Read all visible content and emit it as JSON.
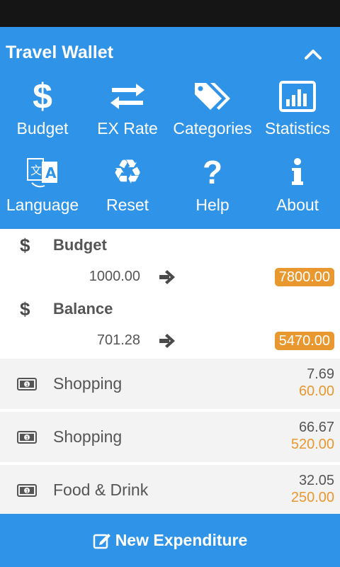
{
  "app": {
    "title": "Travel Wallet",
    "collapse_icon": "chevron-up-icon"
  },
  "menu": [
    {
      "label": "Budget",
      "icon": "dollar-icon"
    },
    {
      "label": "EX Rate",
      "icon": "exchange-arrows-icon"
    },
    {
      "label": "Categories",
      "icon": "tags-icon"
    },
    {
      "label": "Statistics",
      "icon": "bar-chart-icon"
    },
    {
      "label": "Language",
      "icon": "translate-icon"
    },
    {
      "label": "Reset",
      "icon": "recycle-icon"
    },
    {
      "label": "Help",
      "icon": "question-icon"
    },
    {
      "label": "About",
      "icon": "info-icon"
    }
  ],
  "summary": {
    "budget": {
      "title": "Budget",
      "icon": "dollar-icon",
      "local_value": "1000.00",
      "home_value": "7800.00"
    },
    "balance": {
      "title": "Balance",
      "icon": "dollar-icon",
      "local_value": "701.28",
      "home_value": "5470.00"
    }
  },
  "expenditures": [
    {
      "category": "Shopping",
      "local_amount": "7.69",
      "home_amount": "60.00",
      "icon": "money-icon"
    },
    {
      "category": "Shopping",
      "local_amount": "66.67",
      "home_amount": "520.00",
      "icon": "money-icon"
    },
    {
      "category": "Food & Drink",
      "local_amount": "32.05",
      "home_amount": "250.00",
      "icon": "money-icon"
    }
  ],
  "footer": {
    "label": "New Expenditure",
    "icon": "edit-icon"
  },
  "colors": {
    "primary": "#2f93e8",
    "accent": "#e8982f",
    "status_bar": "#151515",
    "row_bg": "#f3f3f3"
  }
}
